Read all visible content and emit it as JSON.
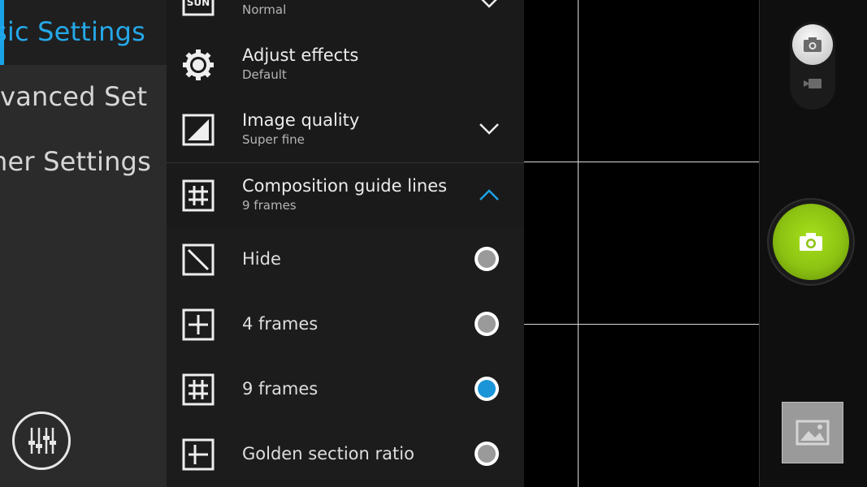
{
  "sidebar": {
    "tabs": [
      {
        "label": "sic Settings",
        "active": true
      },
      {
        "label": "lvanced Set",
        "active": false
      },
      {
        "label": "her Settings",
        "active": false
      }
    ],
    "settings_icon": "equalizer-icon"
  },
  "settings": {
    "rows": [
      {
        "title": "",
        "subtitle": "Normal",
        "icon": "scene-icon",
        "chevron": "down"
      },
      {
        "title": "Adjust effects",
        "subtitle": "Default",
        "icon": "effects-gear-icon"
      },
      {
        "title": "Image quality",
        "subtitle": "Super fine",
        "icon": "image-quality-icon",
        "chevron": "down"
      },
      {
        "title": "Composition guide lines",
        "subtitle": "9 frames",
        "icon": "grid-icon",
        "chevron": "up"
      }
    ],
    "options": [
      {
        "label": "Hide",
        "icon": "hide-grid-icon",
        "selected": false
      },
      {
        "label": "4 frames",
        "icon": "four-frames-icon",
        "selected": false
      },
      {
        "label": "9 frames",
        "icon": "nine-frames-icon",
        "selected": true
      },
      {
        "label": "Golden section ratio",
        "icon": "golden-ratio-icon",
        "selected": false
      }
    ]
  },
  "controls": {
    "mode_photo_icon": "camera-icon",
    "mode_video_icon": "video-icon",
    "shutter_icon": "camera-icon",
    "gallery_icon": "gallery-icon"
  },
  "colors": {
    "accent": "#1aa3e8",
    "shutter": "#8cc212",
    "panel": "#1a1a1a",
    "sidebar": "#2b2b2b"
  }
}
